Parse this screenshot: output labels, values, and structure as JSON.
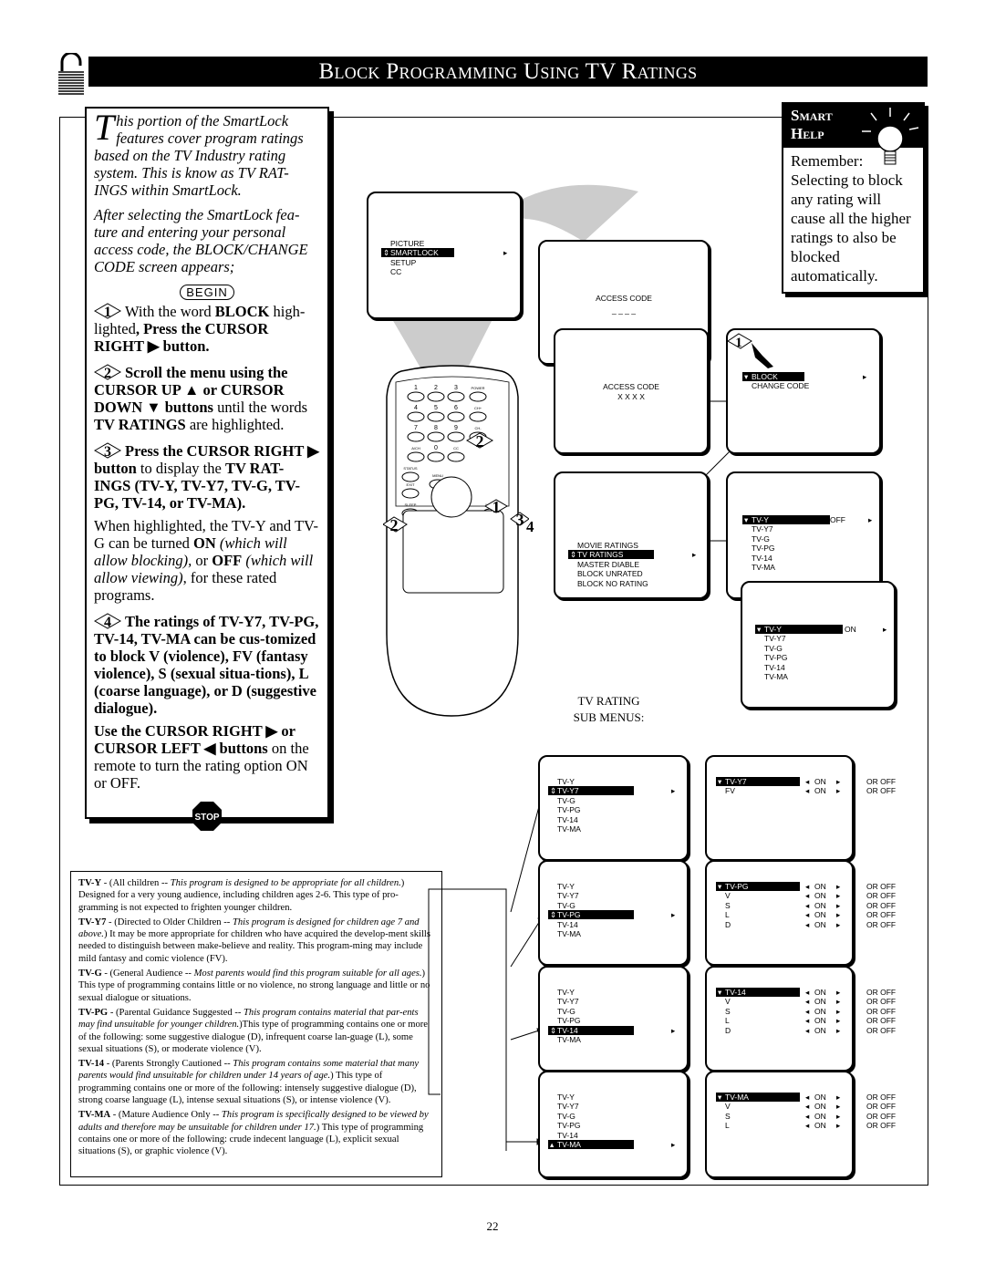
{
  "header": {
    "title": "Block Programming Using TV Ratings"
  },
  "instructions": {
    "intro1": "his portion of the SmartLock features cover program ratings based on the TV Industry rating system. This is know as TV RAT-INGS within SmartLock.",
    "intro1_dropcap": "T",
    "intro2": "After selecting the SmartLock fea-ture and entering your personal access code, the BLOCK/CHANGE CODE screen appears;",
    "begin_label": "BEGIN",
    "steps": [
      {
        "num": "1",
        "text_a": "With the word ",
        "bold_a": "BLOCK",
        "text_b": " high-lighted",
        "bold_b": ", Press the CURSOR RIGHT ▶ button."
      },
      {
        "num": "2",
        "bold_a": "Scroll the menu using the CURSOR UP ▲ or CURSOR DOWN ▼ buttons",
        "text_b": " until the words ",
        "bold_b": "TV RATINGS",
        "text_c": " are highlighted."
      },
      {
        "num": "3",
        "bold_a": "Press the CURSOR RIGHT ▶ button",
        "text_b": " to display the ",
        "bold_b": "TV RAT-INGS (TV-Y, TV-Y7, TV-G, TV-PG, TV-14, or TV-MA).",
        "para2": {
          "a": "When highlighted, the TV-Y and TV-G can be turned ",
          "b": "ON",
          "c": " (which will allow blocking),",
          "d": " or ",
          "e": "OFF",
          "f": " (which will allow viewing)",
          "g": ", for these rated programs."
        }
      },
      {
        "num": "4",
        "bold_a": "The ratings of TV-Y7, TV-PG, TV-14, TV-MA can be cus-tomized to block V (violence), FV (fantasy violence), S (sexual situa-tions), L (coarse language), or D (suggestive dialogue).",
        "para2": {
          "a": "Use the CURSOR RIGHT ▶ or CURSOR LEFT ◀ buttons",
          "b": " on the remote to turn the rating option ON or OFF."
        }
      }
    ],
    "stop_label": "STOP"
  },
  "smart_help": {
    "title1": "Smart",
    "title2": "Help",
    "text": "Remember: Selecting to block any rating will cause all the higher ratings to also be blocked automatically."
  },
  "screens": {
    "main_menu": {
      "items": [
        "PICTURE",
        "SMARTLOCK",
        "SETUP",
        "CC"
      ],
      "selected": 1
    },
    "access_code_empty": {
      "label": "ACCESS CODE",
      "value": "_ _ _ _"
    },
    "access_code_entered": {
      "label": "ACCESS CODE",
      "value": "X X X X"
    },
    "block_menu": {
      "items": [
        "BLOCK",
        "CHANGE CODE"
      ],
      "selected": 0
    },
    "ratings_menu": {
      "items": [
        "MOVIE RATINGS",
        "TV RATINGS",
        "MASTER DIABLE",
        "BLOCK UNRATED",
        "BLOCK NO RATING"
      ],
      "selected": 1
    },
    "tvy_off": {
      "items": [
        "TV-Y",
        "TV-Y7",
        "TV-G",
        "TV-PG",
        "TV-14",
        "TV-MA"
      ],
      "value": "OFF"
    },
    "tvy_on": {
      "items": [
        "TV-Y",
        "TV-Y7",
        "TV-G",
        "TV-PG",
        "TV-14",
        "TV-MA"
      ],
      "value": "ON"
    }
  },
  "remote": {
    "keys": [
      "1",
      "2",
      "3",
      "POWER",
      "4",
      "5",
      "6",
      "CH+",
      "7",
      "8",
      "9",
      "CH-",
      "A/CH",
      "0",
      "CC",
      "STATUS",
      "EXIT",
      "MENU",
      "SLEEP",
      "MUTE"
    ],
    "callouts": [
      "1",
      "2",
      "3",
      "4",
      "2"
    ]
  },
  "sub_menus_caption": [
    "TV RATING",
    "SUB MENUS:"
  ],
  "sub_menus": [
    {
      "list": [
        "TV-Y",
        "TV-Y7",
        "TV-G",
        "TV-PG",
        "TV-14",
        "TV-MA"
      ],
      "selected": 1,
      "options": [
        {
          "name": "TV-Y7",
          "value": "ON"
        },
        {
          "name": "FV",
          "value": "ON"
        }
      ]
    },
    {
      "list": [
        "TV-Y",
        "TV-Y7",
        "TV-G",
        "TV-PG",
        "TV-14",
        "TV-MA"
      ],
      "selected": 3,
      "options": [
        {
          "name": "TV-PG",
          "value": "ON"
        },
        {
          "name": "V",
          "value": "ON"
        },
        {
          "name": "S",
          "value": "ON"
        },
        {
          "name": "L",
          "value": "ON"
        },
        {
          "name": "D",
          "value": "ON"
        }
      ]
    },
    {
      "list": [
        "TV-Y",
        "TV-Y7",
        "TV-G",
        "TV-PG",
        "TV-14",
        "TV-MA"
      ],
      "selected": 4,
      "options": [
        {
          "name": "TV-14",
          "value": "ON"
        },
        {
          "name": "V",
          "value": "ON"
        },
        {
          "name": "S",
          "value": "ON"
        },
        {
          "name": "L",
          "value": "ON"
        },
        {
          "name": "D",
          "value": "ON"
        }
      ]
    },
    {
      "list": [
        "TV-Y",
        "TV-Y7",
        "TV-G",
        "TV-PG",
        "TV-14",
        "TV-MA"
      ],
      "selected": 5,
      "options": [
        {
          "name": "TV-MA",
          "value": "ON"
        },
        {
          "name": "V",
          "value": "ON"
        },
        {
          "name": "S",
          "value": "ON"
        },
        {
          "name": "L",
          "value": "ON"
        }
      ]
    }
  ],
  "or_off_label": "OR OFF",
  "ratings_text": [
    {
      "code": "TV-Y",
      "a": " - (All children -- ",
      "i": "This program is designed to be appropriate for all children.",
      "b": ") Designed for a very young audience, including children ages 2-6. This type of pro-gramming is not expected to frighten younger children."
    },
    {
      "code": "TV-Y7",
      "a": " - (Directed to Older Children -- ",
      "i": "This program is designed for children age 7 and above.",
      "b": ") It may be more appropriate for children who have acquired the develop-ment skills needed to distinguish between make-believe and reality. This program-ming may include mild fantasy and comic violence (FV)."
    },
    {
      "code": "TV-G",
      "a": " - (General Audience -- ",
      "i": "Most parents would find this program suitable for all ages.",
      "b": ") This type of programming contains little or no violence, no strong language and little or no sexual dialogue or situations."
    },
    {
      "code": "TV-PG",
      "a": " - (Parental Guidance Suggested -- ",
      "i": "This program contains material that par-ents may find unsuitable for younger children.",
      "b": ")This type of programming contains one or more of the following: some suggestive dialogue (D), infrequent coarse lan-guage (L), some sexual situations (S), or moderate violence (V)."
    },
    {
      "code": "TV-14",
      "a": " - (Parents Strongly Cautioned -- ",
      "i": "This program contains some material that many parents would find unsuitable for children under 14 years of age.",
      "b": ") This type of programming contains one or more of the following: intensely suggestive dialogue (D), strong coarse language (L), intense sexual situations (S), or intense violence (V)."
    },
    {
      "code": "TV-MA",
      "a": " - (Mature Audience Only -- ",
      "i": "This program is specifically designed to be viewed by adults and therefore may be unsuitable for children under 17.",
      "b": ") This type of programming contains one or more of the following: crude indecent language (L), explicit sexual situations (S), or graphic violence (V)."
    }
  ],
  "page_number": "22"
}
